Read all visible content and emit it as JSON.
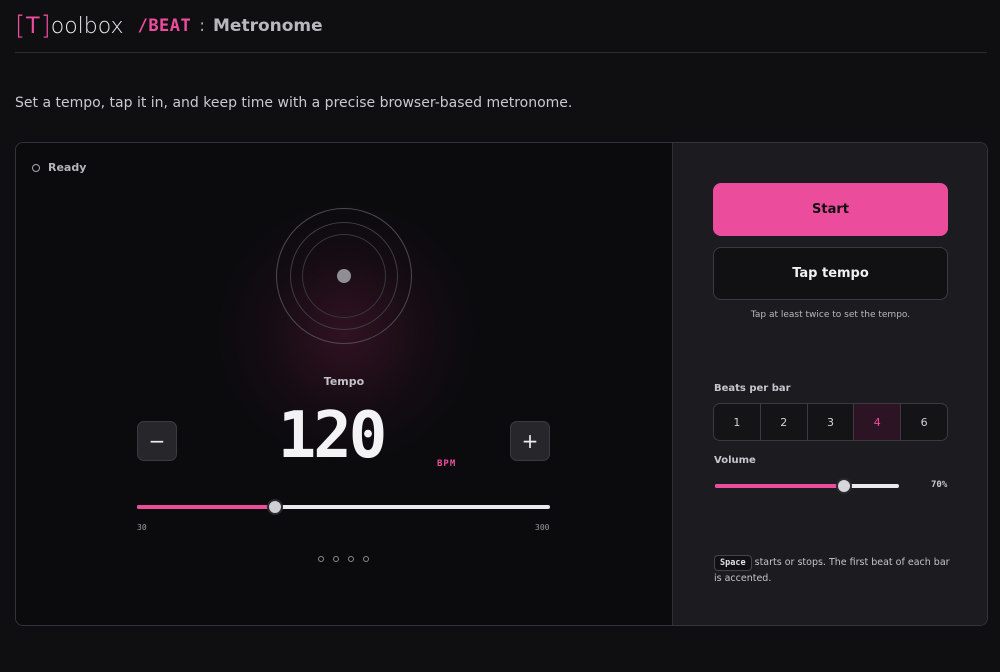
{
  "header": {
    "logo_bracket_open": "[",
    "logo_letter": "T",
    "logo_bracket_close": "]",
    "logo_rest": "oolbox",
    "crumb": "/BEAT",
    "separator": ":",
    "tool_name": "Metronome"
  },
  "description": "Set a tempo, tap it in, and keep time with a precise browser-based metronome.",
  "metronome": {
    "status": "Ready",
    "tempo_label": "Tempo",
    "bpm": "120",
    "bpm_unit": "BPM",
    "decrement_label": "−",
    "increment_label": "+",
    "tempo_min": "30",
    "tempo_max": "300",
    "tempo_value": 120,
    "beat_indicators": 4
  },
  "controls": {
    "start_label": "Start",
    "tap_label": "Tap tempo",
    "tap_hint": "Tap at least twice to set the tempo.",
    "beats_per_bar_label": "Beats per bar",
    "beats_per_bar_options": [
      "1",
      "2",
      "3",
      "4",
      "6"
    ],
    "beats_per_bar_selected": "4",
    "volume_label": "Volume",
    "volume_value": "70%",
    "volume_fraction": 0.7,
    "help_key": "Space",
    "help_text": "starts or stops. The first beat of each bar is accented."
  },
  "colors": {
    "accent": "#ec4c9c",
    "background": "#0f0f12",
    "panel": "#1c1c20"
  }
}
